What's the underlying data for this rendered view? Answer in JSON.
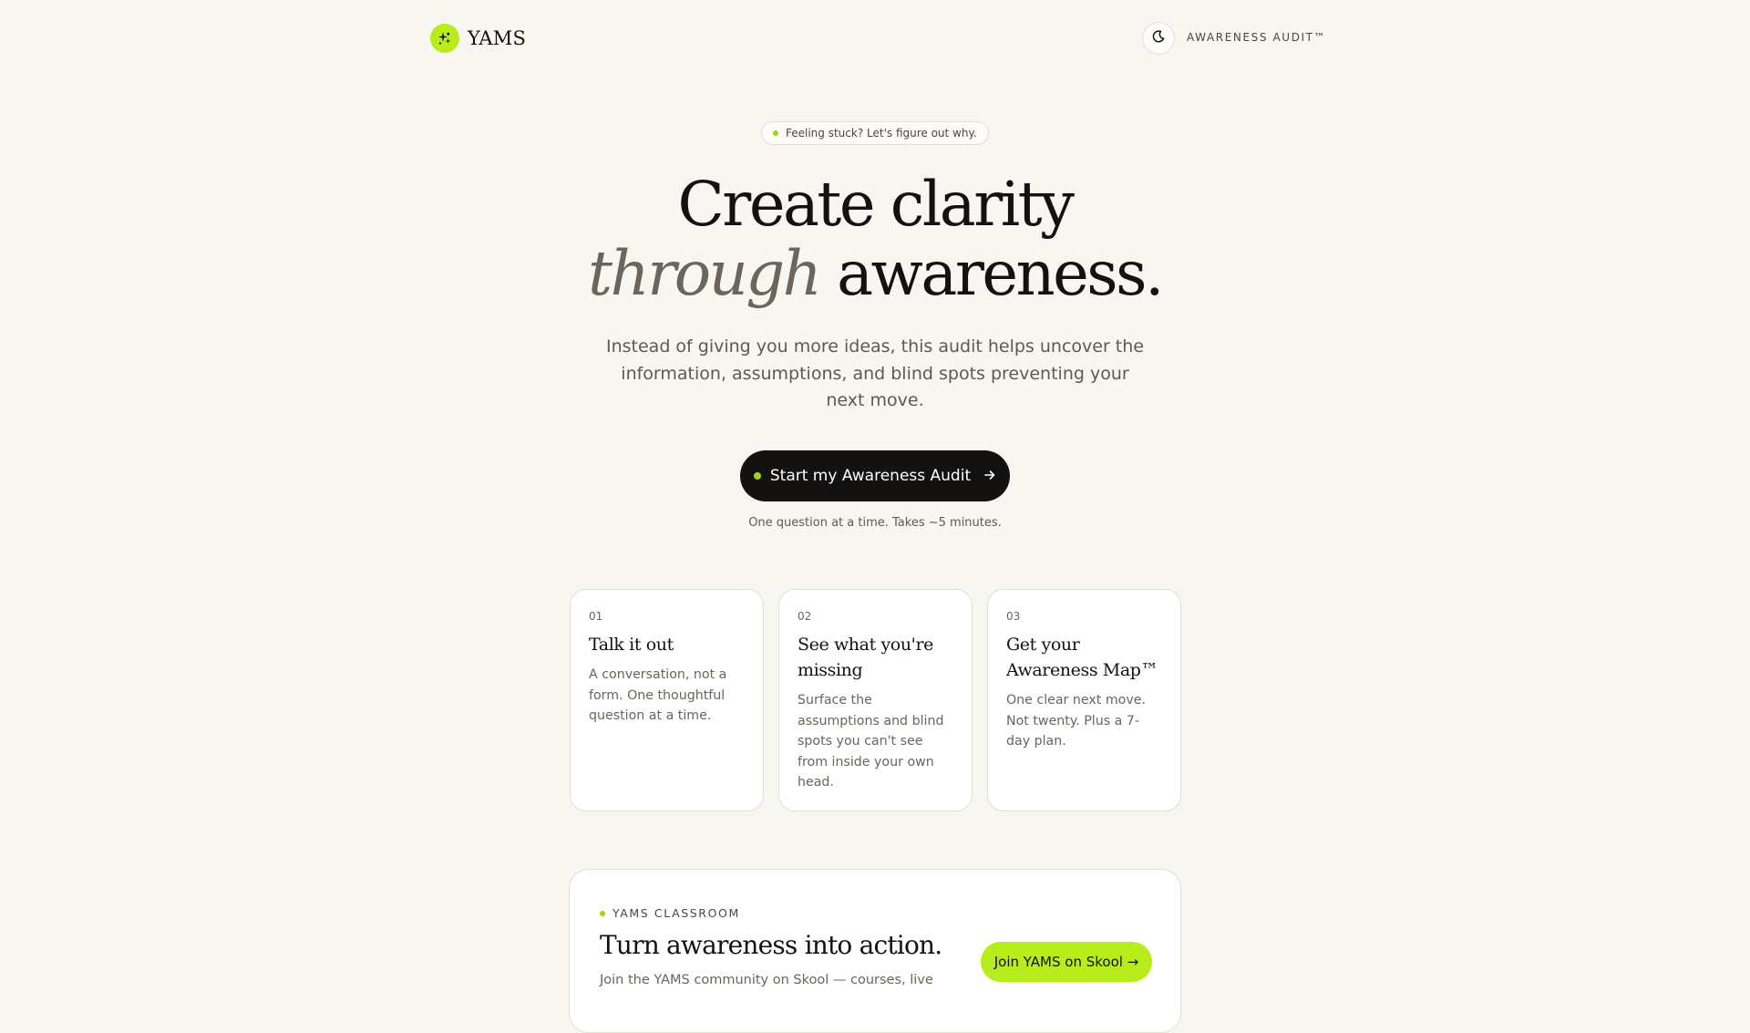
{
  "colors": {
    "accent": "#b8ec1a",
    "background": "#f8f6f1",
    "ink": "#141210",
    "muted": "#6b655b"
  },
  "header": {
    "brand": "YAMS",
    "logo_icon": "sparkle-icon",
    "theme_toggle_icon": "moon-icon",
    "label": "AWARENESS AUDIT™"
  },
  "hero": {
    "pill_text": "Feeling stuck? Let's figure out why.",
    "title_line1": "Create clarity",
    "title_accent": "through",
    "title_rest": "awareness.",
    "subtitle": "Instead of giving you more ideas, this audit helps uncover the information, assumptions, and blind spots preventing your next move.",
    "cta_label": "Start my Awareness Audit",
    "cta_icon": "arrow-right-icon",
    "cta_note": "One question at a time. Takes ~5 minutes."
  },
  "steps": [
    {
      "number": "01",
      "title": "Talk it out",
      "body": "A conversation, not a form. One thoughtful question at a time."
    },
    {
      "number": "02",
      "title": "See what you're missing",
      "body": "Surface the assumptions and blind spots you can't see from inside your own head."
    },
    {
      "number": "03",
      "title": "Get your Awareness Map™",
      "body": "One clear next move. Not twenty. Plus a 7-day plan."
    }
  ],
  "classroom": {
    "kicker": "YAMS CLASSROOM",
    "title": "Turn awareness into action.",
    "body": "Join the YAMS community on Skool — courses, live",
    "button_label": "Join YAMS on Skool →"
  }
}
